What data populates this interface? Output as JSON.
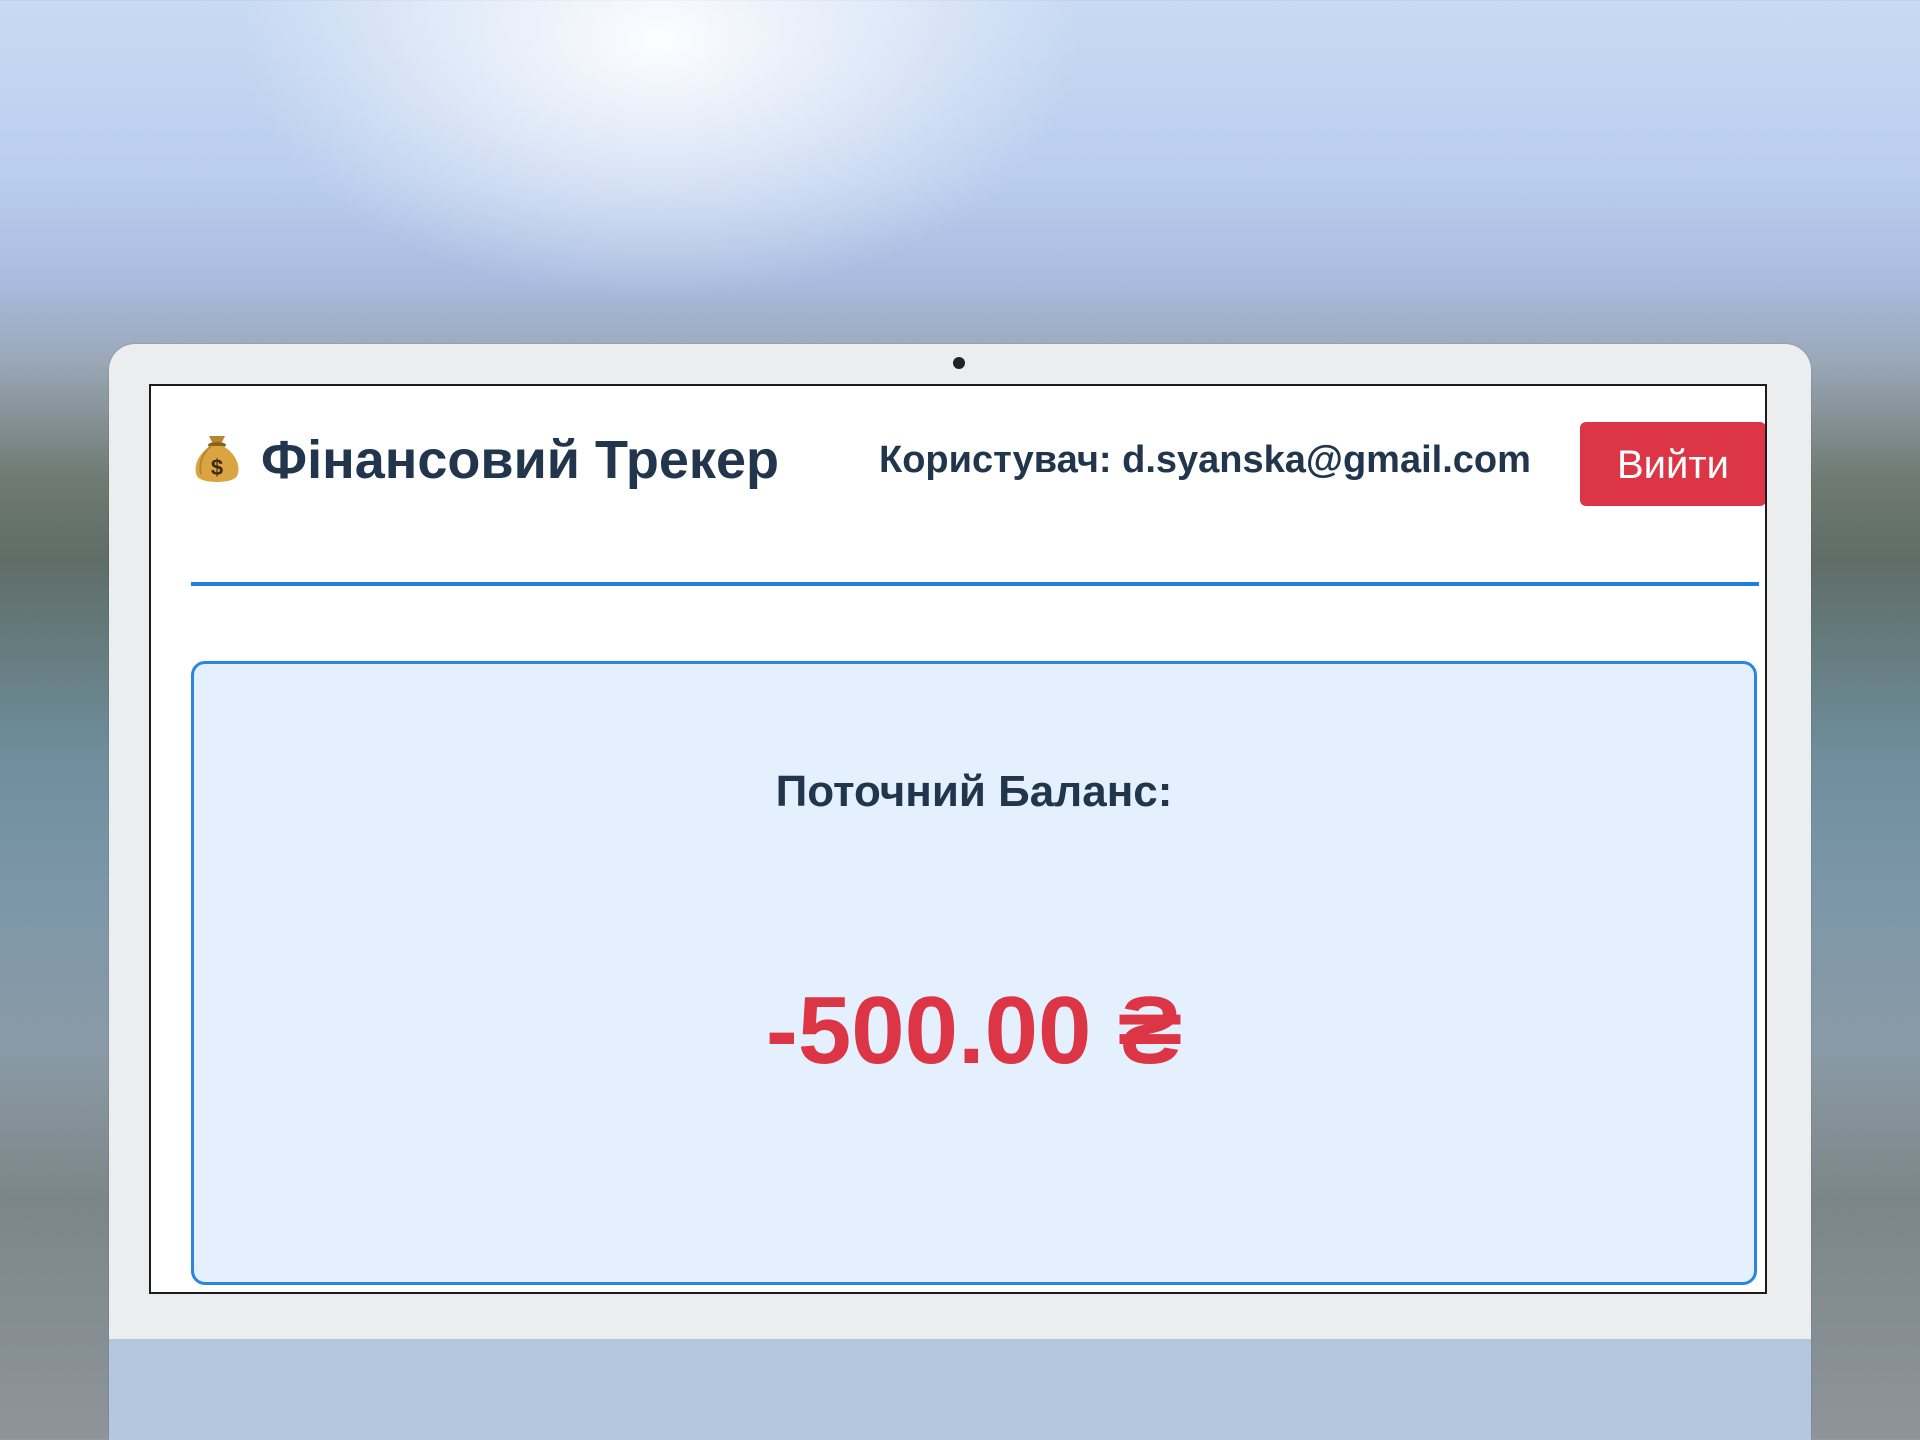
{
  "header": {
    "logo_icon": "money-bag-icon",
    "app_title": "Фінансовий Трекер",
    "user_text": "Користувач: d.syanska@gmail.com",
    "logout_label": "Вийти"
  },
  "balance": {
    "label": "Поточний Баланс:",
    "value": "-500.00 ₴"
  },
  "colors": {
    "accent": "#1f7fe0",
    "danger": "#dc3545",
    "text": "#21364c",
    "card_bg": "#e4f0fd"
  }
}
